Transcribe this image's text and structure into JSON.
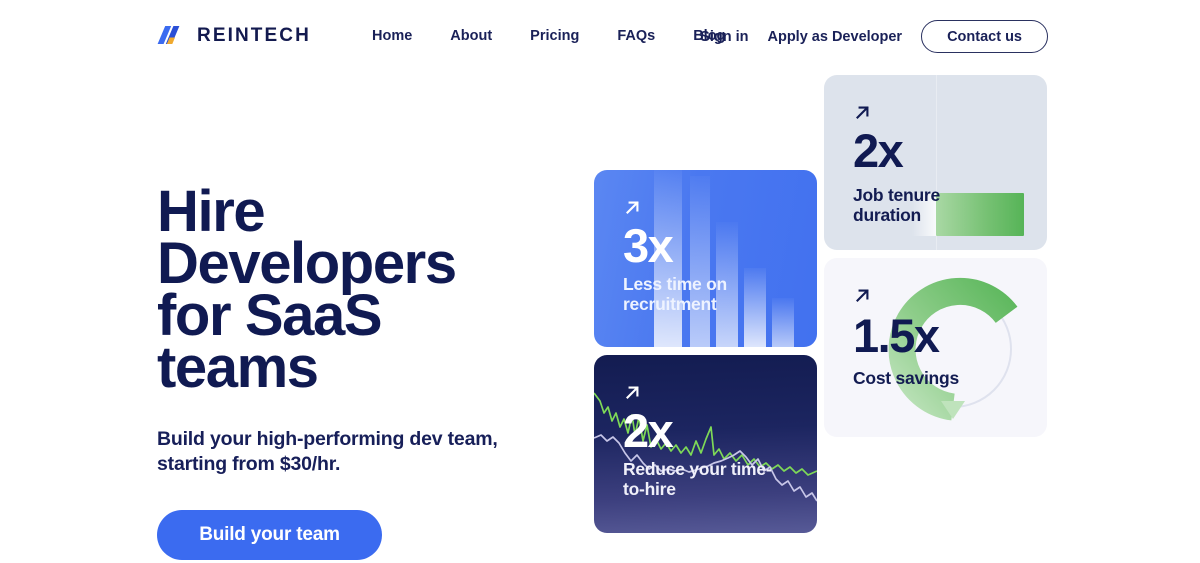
{
  "header": {
    "logo": {
      "icon": "reintech-logo-icon",
      "name": "REINTECH"
    },
    "nav": [
      {
        "label": "Home"
      },
      {
        "label": "About"
      },
      {
        "label": "Pricing"
      },
      {
        "label": "FAQs"
      },
      {
        "label": "Blog"
      }
    ],
    "actions": {
      "sign_in": "Sign in",
      "apply": "Apply as Developer",
      "contact": "Contact us"
    }
  },
  "hero": {
    "title": "Hire\nDevelopers\nfor SaaS\nteams",
    "subtitle": "Build your high-performing dev team,\nstarting from $30/hr.",
    "cta_label": "Build your team"
  },
  "cards": {
    "recruitment": {
      "icon": "arrow-up-right-icon",
      "value": "3x",
      "label": "Less time on\nrecruitment"
    },
    "timetohire": {
      "icon": "arrow-up-right-icon",
      "value": "2x",
      "label": "Reduce your time-\nto-hire"
    },
    "tenure": {
      "icon": "arrow-up-right-icon",
      "value": "2x",
      "label": "Job tenure\nduration"
    },
    "savings": {
      "icon": "arrow-up-right-icon",
      "value": "1.5x",
      "label": "Cost savings"
    }
  },
  "colors": {
    "brand_navy": "#101a52",
    "brand_blue": "#3b6bf0",
    "card_blue": "#4a78f0",
    "card_navy": "#131c51",
    "card_grey": "#dde3ec",
    "card_offwhite": "#f6f6fb",
    "accent_green": "#6ec16e",
    "logo_orange": "#f0a92e"
  }
}
